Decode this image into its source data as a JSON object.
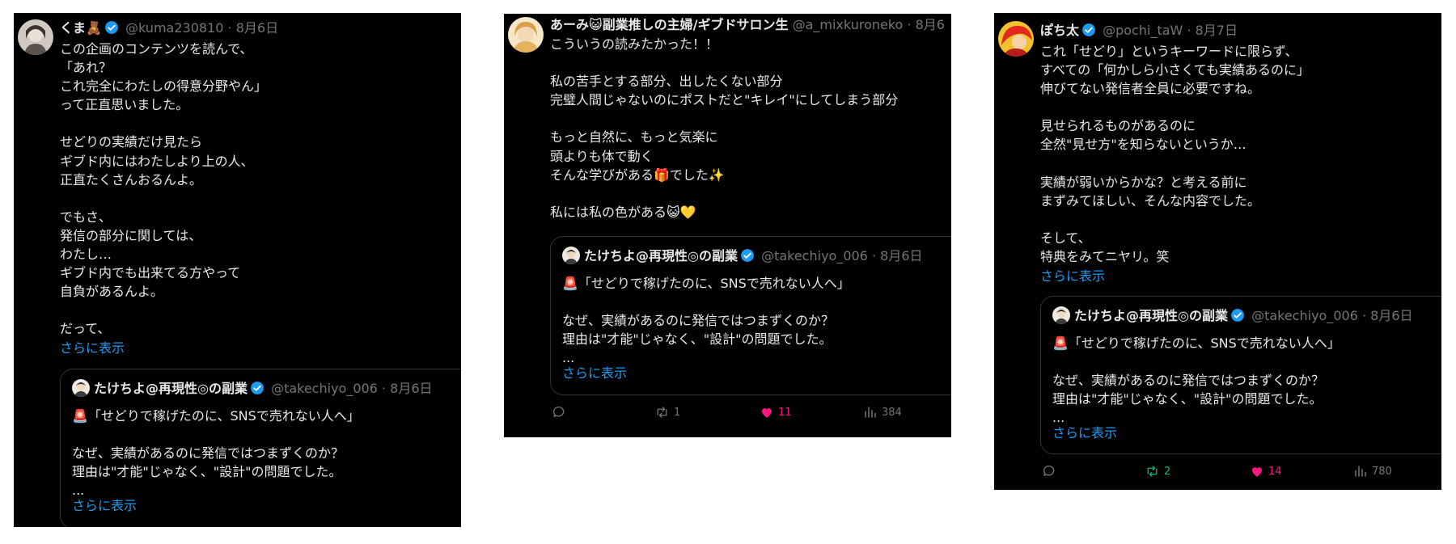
{
  "tweets": [
    {
      "name": "くま🧸",
      "handle": "@kuma230810",
      "date": "8月6日",
      "body": "この企画のコンテンツを読んで、\n「あれ？\nこれ完全にわたしの得意分野やん」\nって正直思いました。\n\nせどりの実績だけ見たら\nギブド内にはわたしより上の人、\n正直たくさんおるんよ。\n\nでもさ、\n発信の部分に関しては、\nわたし…\nギブド内でも出来てる方やって\n自負があるんよ。\n\nだって、",
      "show_more": "さらに表示",
      "quote": {
        "name": "たけちよ@再現性◎の副業",
        "handle": "@takechiyo_006",
        "date": "8月6日",
        "body": "🚨「せどりで稼げたのに、SNSで売れない人へ」\n\nなぜ、実績があるのに発信ではつまずくのか？\n理由は\"才能\"じゃなく、\"設計\"の問題でした。\n...",
        "show_more": "さらに表示"
      }
    },
    {
      "name": "あーみ😺副業推しの主婦/ギブドサロン生",
      "handle": "@a_mixkuroneko",
      "date": "8月6",
      "body": "こういうの読みたかった！！\n\n私の苦手とする部分、出したくない部分\n完璧人間じゃないのにポストだと\"キレイ\"にしてしまう部分\n\nもっと自然に、もっと気楽に\n頭よりも体で動く\nそんな学びがある🎁でした✨\n\n私には私の色がある😺💛",
      "quote": {
        "name": "たけちよ@再現性◎の副業",
        "handle": "@takechiyo_006",
        "date": "8月6日",
        "body": "🚨「せどりで稼げたのに、SNSで売れない人へ」\n\nなぜ、実績があるのに発信ではつまずくのか？\n理由は\"才能\"じゃなく、\"設計\"の問題でした。\n...",
        "show_more": "さらに表示"
      },
      "stats": {
        "reposts": "1",
        "likes": "11",
        "views": "384"
      }
    },
    {
      "name": "ぽち太",
      "handle": "@pochi_taW",
      "date": "8月7日",
      "body": "これ「せどり」というキーワードに限らず、\nすべての「何かしら小さくても実績あるのに」\n伸びてない発信者全員に必要ですね。\n\n見せられるものがあるのに\n全然\"見せ方\"を知らないというか…\n\n実績が弱いからかな？と考える前に\nまずみてほしい、そんな内容でした。\n\nそして、\n特典をみてニヤリ。笑",
      "show_more": "さらに表示",
      "quote": {
        "name": "たけちよ@再現性◎の副業",
        "handle": "@takechiyo_006",
        "date": "8月6日",
        "body": "🚨「せどりで稼げたのに、SNSで売れない人へ」\n\nなぜ、実績があるのに発信ではつまずくのか？\n理由は\"才能\"じゃなく、\"設計\"の問題でした。\n...",
        "show_more": "さらに表示"
      },
      "stats": {
        "reposts": "2",
        "likes": "14",
        "views": "780"
      }
    }
  ],
  "sep": "·",
  "icons": {
    "verified": "verified-badge-icon",
    "reply": "reply-icon",
    "repost": "repost-icon",
    "like": "heart-icon",
    "views": "views-icon"
  },
  "colors": {
    "background": "#000000",
    "text": "#e7e9ea",
    "muted": "#71767b",
    "link": "#1d9bf0",
    "like": "#f91880",
    "repost": "#00ba7c",
    "verified": "#1d9bf0",
    "border": "#2f3336"
  }
}
